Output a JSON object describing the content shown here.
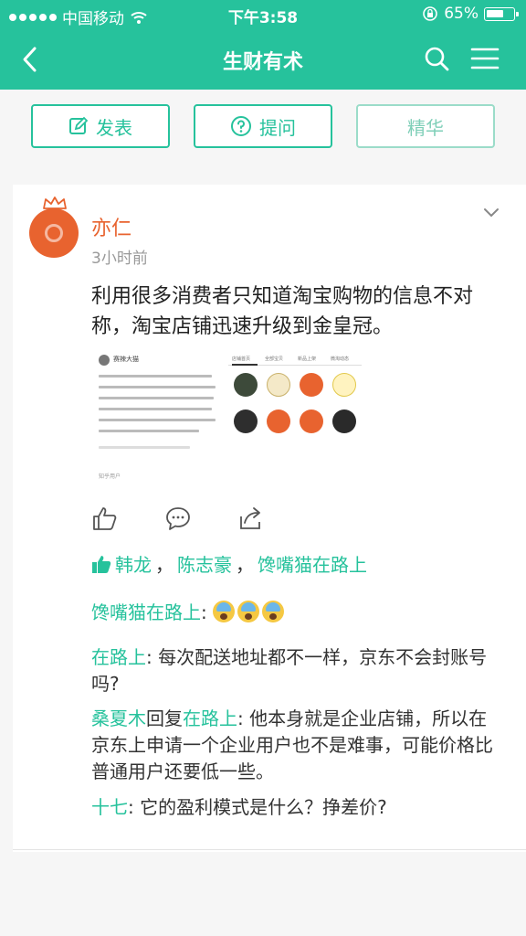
{
  "status_bar": {
    "carrier": "中国移动",
    "time": "下午3:58",
    "battery": "65%",
    "battery_level": 0.65
  },
  "nav": {
    "title": "生财有术",
    "back_icon": "chevron-left-icon",
    "search_icon": "search-icon",
    "menu_icon": "hamburger-menu-icon"
  },
  "actions": {
    "post_label": "发表",
    "ask_label": "提问",
    "featured_label": "精华"
  },
  "post": {
    "author": "亦仁",
    "time": "3小时前",
    "text": "利用很多消费者只知道淘宝购物的信息不对称，淘宝店铺迅速升级到金皇冠。",
    "image": {
      "left_name": "赛辣大猫",
      "left_brand": "知乎用户",
      "tabs": [
        "店铺首页",
        "全部宝贝",
        "新品上架",
        "微淘动态"
      ]
    }
  },
  "likes": {
    "users": [
      "韩龙",
      "陈志豪",
      "馋嘴猫在路上"
    ],
    "separator": "，"
  },
  "comments": [
    {
      "user": "馋嘴猫在路上",
      "sep": ": ",
      "text": ""
    },
    {
      "user": "在路上",
      "sep": ": ",
      "text": "每次配送地址都不一样，京东不会封账号吗?"
    },
    {
      "user": "桑夏木",
      "reply_word": "回复",
      "reply_to": "在路上",
      "sep": ": ",
      "text": "他本身就是企业店铺，所以在京东上申请一个企业用户也不是难事，可能价格比普通用户还要低一些。"
    },
    {
      "user": "十七",
      "sep": ": ",
      "text": "它的盈利模式是什么？挣差价?"
    }
  ],
  "colors": {
    "accent": "#26c29c",
    "author": "#e8632f"
  }
}
